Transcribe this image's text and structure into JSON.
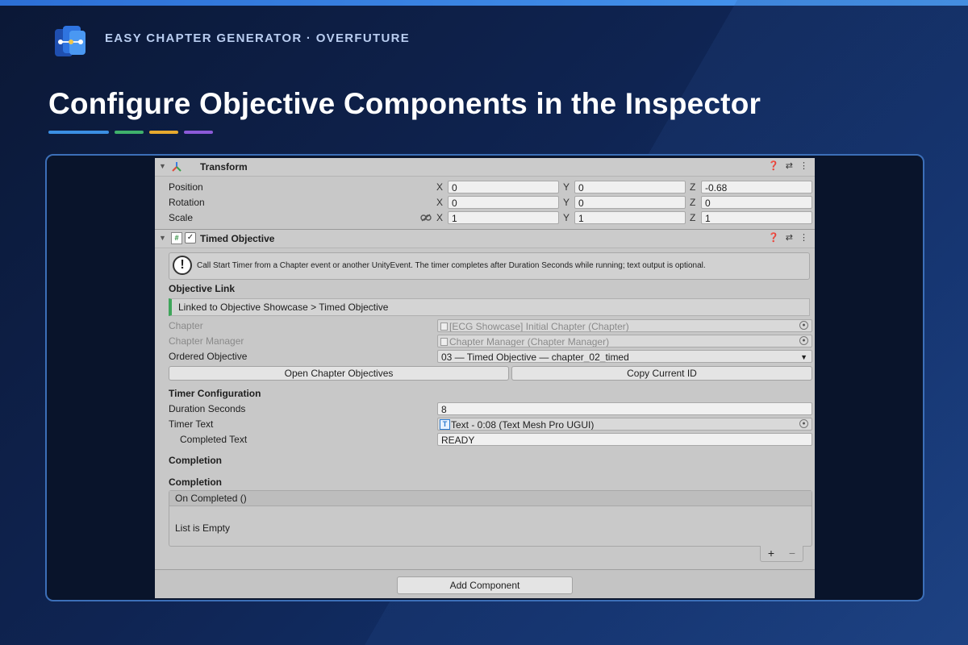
{
  "brand": {
    "text": "EASY CHAPTER GENERATOR · OVERFUTURE"
  },
  "headline": {
    "text": "Configure Objective Components in the Inspector"
  },
  "accent_colors": [
    "#3b8fe3",
    "#3fb16b",
    "#e6a92e",
    "#8b5ad8"
  ],
  "transform": {
    "title": "Transform",
    "position": {
      "label": "Position",
      "x": "0",
      "y": "0",
      "z": "-0.68"
    },
    "rotation": {
      "label": "Rotation",
      "x": "0",
      "y": "0",
      "z": "0"
    },
    "scale": {
      "label": "Scale",
      "x": "1",
      "y": "1",
      "z": "1"
    },
    "axis_labels": {
      "x": "X",
      "y": "Y",
      "z": "Z"
    }
  },
  "timed": {
    "title": "Timed Objective",
    "enabled": true,
    "help_text": "Call Start Timer from a Chapter event or another UnityEvent. The timer completes after Duration Seconds while running; text output is optional.",
    "objective_link_heading": "Objective Link",
    "link_status": "Linked to Objective Showcase > Timed Objective",
    "chapter": {
      "label": "Chapter",
      "value": "[ECG Showcase] Initial Chapter (Chapter)"
    },
    "chapter_manager": {
      "label": "Chapter Manager",
      "value": "Chapter Manager (Chapter Manager)"
    },
    "ordered_objective": {
      "label": "Ordered Objective",
      "value": "03 — Timed Objective — chapter_02_timed"
    },
    "open_objectives_button": "Open Chapter Objectives",
    "copy_id_button": "Copy Current ID",
    "timer_heading": "Timer Configuration",
    "duration": {
      "label": "Duration Seconds",
      "value": "8"
    },
    "timer_text": {
      "label": "Timer Text",
      "value": "Text - 0:08 (Text Mesh Pro UGUI)"
    },
    "completed_text": {
      "label": "Completed Text",
      "value": "READY"
    },
    "completion_heading_1": "Completion",
    "completion_heading_2": "Completion",
    "event_name": "On Completed ()",
    "event_empty": "List is Empty",
    "add_symbol": "+",
    "remove_symbol": "−"
  },
  "add_component_button": "Add Component"
}
